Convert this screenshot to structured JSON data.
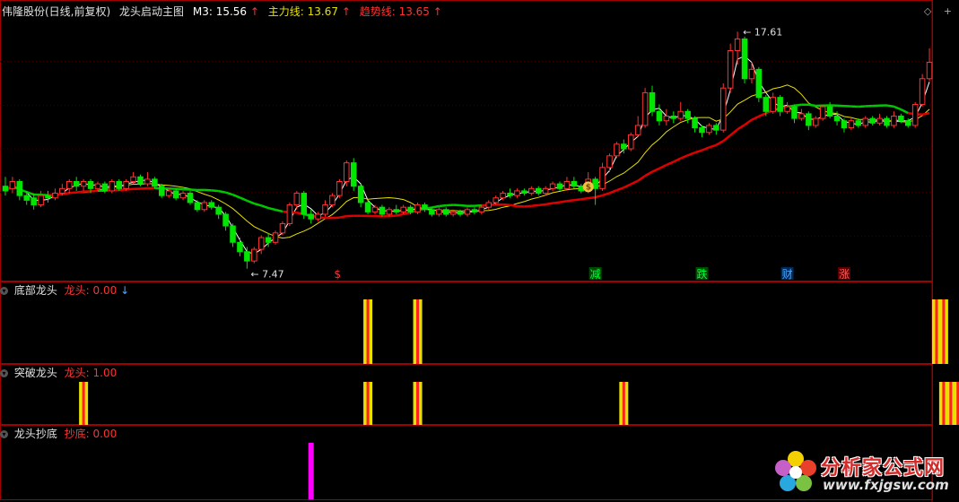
{
  "header": {
    "stock": "伟隆股份(日线,前复权)",
    "indicator": "龙头启动主图",
    "m3_label": "M3: 15.56",
    "main_line_label": "主力线: 13.67",
    "trend_line_label": "趋势线: 13.65",
    "up_arrow": "↑"
  },
  "hud": {
    "diamond": "◇",
    "plus": "+"
  },
  "annotations": {
    "high": "17.61",
    "low": "7.47",
    "money_bag": "$"
  },
  "signals": {
    "s": "$",
    "jian": "减",
    "die": "跌",
    "cai": "财",
    "zhang": "涨"
  },
  "panels": {
    "bottom_dragon": {
      "title": "底部龙头",
      "series_label": "龙头: 0.00",
      "arrow": "↓"
    },
    "breakout_dragon": {
      "title": "突破龙头",
      "series_label": "龙头: 1.00"
    },
    "dragon_bottom": {
      "title": "龙头抄底",
      "series_label": "抄底: 0.00"
    }
  },
  "logo": {
    "name": "分析家公式网",
    "url": "www.fxjgsw.com"
  },
  "colors": {
    "up": "#ff3232",
    "down": "#00e600",
    "ma_white": "#ffffff",
    "ma_yellow": "#e8e000",
    "ma_green": "#00c800",
    "ma_red": "#e00000",
    "signal_yellow": "#e8e000",
    "signal_red": "#ff2020",
    "magenta": "#ff00ff"
  },
  "chart_data": {
    "type": "candlestick",
    "price_range": [
      7.0,
      18.2
    ],
    "candles": [
      [
        11.0,
        10.8,
        11.4,
        10.6
      ],
      [
        10.9,
        11.2,
        11.4,
        10.7
      ],
      [
        11.2,
        10.6,
        11.3,
        10.4
      ],
      [
        10.6,
        10.4,
        10.8,
        10.2
      ],
      [
        10.5,
        10.2,
        10.7,
        10.0
      ],
      [
        10.2,
        10.6,
        10.8,
        10.1
      ],
      [
        10.6,
        10.5,
        10.8,
        10.3
      ],
      [
        10.5,
        10.7,
        10.9,
        10.4
      ],
      [
        10.7,
        10.9,
        11.1,
        10.6
      ],
      [
        10.9,
        11.2,
        11.3,
        10.7
      ],
      [
        11.2,
        11.0,
        11.4,
        10.8
      ],
      [
        11.0,
        11.2,
        11.3,
        10.8
      ],
      [
        11.2,
        10.9,
        11.3,
        10.7
      ],
      [
        10.9,
        11.1,
        11.2,
        10.8
      ],
      [
        11.1,
        10.8,
        11.2,
        10.7
      ],
      [
        10.8,
        11.2,
        11.3,
        10.7
      ],
      [
        11.2,
        10.9,
        11.3,
        10.8
      ],
      [
        10.9,
        11.2,
        11.3,
        10.8
      ],
      [
        11.2,
        11.4,
        11.6,
        11.1
      ],
      [
        11.4,
        11.1,
        11.5,
        11.0
      ],
      [
        11.1,
        11.3,
        11.6,
        11.0
      ],
      [
        11.3,
        11.0,
        11.4,
        10.9
      ],
      [
        11.0,
        10.6,
        11.1,
        10.5
      ],
      [
        10.6,
        10.8,
        10.9,
        10.5
      ],
      [
        10.8,
        10.5,
        10.9,
        10.4
      ],
      [
        10.5,
        10.7,
        10.8,
        10.4
      ],
      [
        10.7,
        10.3,
        10.8,
        10.2
      ],
      [
        10.3,
        10.0,
        10.4,
        9.9
      ],
      [
        10.0,
        10.3,
        10.4,
        9.9
      ],
      [
        10.3,
        10.1,
        10.4,
        10.0
      ],
      [
        10.1,
        9.8,
        10.2,
        9.6
      ],
      [
        9.8,
        9.3,
        9.9,
        9.1
      ],
      [
        9.3,
        8.6,
        9.4,
        8.4
      ],
      [
        8.6,
        8.2,
        8.8,
        8.0
      ],
      [
        8.2,
        7.8,
        8.4,
        7.47
      ],
      [
        7.8,
        8.3,
        8.4,
        7.7
      ],
      [
        8.3,
        8.8,
        8.9,
        8.1
      ],
      [
        8.8,
        8.6,
        9.0,
        8.4
      ],
      [
        8.6,
        9.0,
        9.1,
        8.5
      ],
      [
        9.0,
        9.4,
        9.5,
        8.9
      ],
      [
        9.4,
        10.2,
        10.3,
        9.3
      ],
      [
        10.2,
        10.7,
        10.8,
        10.0
      ],
      [
        10.7,
        9.8,
        10.8,
        9.6
      ],
      [
        9.8,
        9.6,
        10.0,
        9.4
      ],
      [
        9.6,
        9.8,
        9.9,
        9.5
      ],
      [
        9.8,
        10.2,
        10.4,
        9.7
      ],
      [
        10.2,
        10.6,
        10.7,
        10.1
      ],
      [
        10.6,
        11.2,
        11.3,
        10.5
      ],
      [
        11.2,
        12.0,
        12.1,
        11.0
      ],
      [
        12.0,
        11.0,
        12.2,
        10.8
      ],
      [
        11.0,
        10.3,
        11.1,
        10.1
      ],
      [
        10.3,
        9.9,
        10.4,
        9.8
      ],
      [
        9.9,
        10.1,
        10.2,
        9.8
      ],
      [
        10.1,
        9.8,
        10.2,
        9.7
      ],
      [
        9.8,
        10.0,
        10.1,
        9.7
      ],
      [
        10.0,
        9.9,
        10.2,
        9.8
      ],
      [
        9.9,
        10.1,
        10.2,
        9.8
      ],
      [
        10.1,
        9.9,
        10.2,
        9.8
      ],
      [
        9.9,
        10.2,
        10.3,
        9.8
      ],
      [
        10.2,
        10.0,
        10.3,
        9.9
      ],
      [
        10.0,
        9.8,
        10.1,
        9.7
      ],
      [
        9.8,
        10.0,
        10.1,
        9.7
      ],
      [
        10.0,
        9.8,
        10.1,
        9.7
      ],
      [
        9.8,
        9.9,
        10.0,
        9.7
      ],
      [
        9.9,
        9.8,
        10.0,
        9.7
      ],
      [
        9.8,
        10.0,
        10.1,
        9.7
      ],
      [
        10.0,
        9.9,
        10.1,
        9.8
      ],
      [
        9.9,
        10.1,
        10.2,
        9.8
      ],
      [
        10.1,
        10.3,
        10.4,
        10.0
      ],
      [
        10.3,
        10.5,
        10.6,
        10.2
      ],
      [
        10.5,
        10.7,
        10.8,
        10.4
      ],
      [
        10.7,
        10.6,
        10.9,
        10.5
      ],
      [
        10.6,
        10.8,
        10.9,
        10.5
      ],
      [
        10.8,
        10.7,
        10.9,
        10.6
      ],
      [
        10.7,
        10.9,
        11.0,
        10.6
      ],
      [
        10.9,
        10.7,
        11.0,
        10.6
      ],
      [
        10.7,
        10.9,
        11.0,
        10.6
      ],
      [
        10.9,
        11.1,
        11.2,
        10.8
      ],
      [
        11.1,
        10.9,
        11.2,
        10.8
      ],
      [
        10.9,
        11.2,
        11.4,
        10.8
      ],
      [
        11.2,
        11.0,
        11.4,
        10.9
      ],
      [
        11.0,
        10.8,
        11.1,
        10.7
      ],
      [
        10.8,
        11.3,
        11.6,
        10.7
      ],
      [
        11.3,
        10.9,
        11.4,
        10.2
      ],
      [
        10.9,
        11.8,
        12.0,
        10.8
      ],
      [
        11.8,
        12.3,
        12.4,
        11.6
      ],
      [
        12.3,
        12.8,
        12.9,
        12.2
      ],
      [
        12.8,
        12.6,
        13.0,
        12.4
      ],
      [
        12.6,
        13.2,
        13.3,
        12.5
      ],
      [
        13.2,
        13.6,
        14.0,
        13.1
      ],
      [
        13.6,
        15.0,
        15.2,
        13.5
      ],
      [
        15.0,
        14.2,
        15.3,
        14.0
      ],
      [
        14.2,
        13.8,
        14.5,
        13.6
      ],
      [
        13.8,
        14.0,
        14.3,
        13.6
      ],
      [
        14.0,
        13.9,
        14.2,
        13.7
      ],
      [
        13.9,
        14.2,
        14.6,
        13.8
      ],
      [
        14.2,
        13.9,
        14.3,
        13.7
      ],
      [
        13.9,
        13.5,
        14.0,
        13.3
      ],
      [
        13.5,
        13.3,
        13.6,
        13.1
      ],
      [
        13.3,
        13.6,
        13.7,
        13.2
      ],
      [
        13.6,
        13.4,
        13.7,
        13.2
      ],
      [
        13.4,
        15.2,
        15.4,
        13.3
      ],
      [
        15.2,
        16.8,
        17.1,
        15.0
      ],
      [
        16.8,
        17.3,
        17.61,
        16.2
      ],
      [
        17.3,
        15.6,
        17.4,
        15.4
      ],
      [
        15.6,
        16.0,
        16.3,
        15.4
      ],
      [
        16.0,
        14.8,
        16.1,
        14.6
      ],
      [
        14.8,
        14.2,
        14.9,
        14.0
      ],
      [
        14.2,
        14.8,
        15.0,
        14.1
      ],
      [
        14.8,
        14.2,
        14.9,
        14.0
      ],
      [
        14.2,
        14.4,
        14.6,
        14.1
      ],
      [
        14.4,
        13.9,
        14.5,
        13.7
      ],
      [
        13.9,
        14.1,
        14.3,
        13.8
      ],
      [
        14.1,
        13.6,
        14.2,
        13.4
      ],
      [
        13.6,
        13.9,
        14.0,
        13.5
      ],
      [
        13.9,
        14.4,
        14.5,
        13.8
      ],
      [
        14.4,
        14.0,
        14.6,
        13.9
      ],
      [
        14.0,
        13.8,
        14.2,
        13.6
      ],
      [
        13.8,
        13.5,
        13.9,
        13.3
      ],
      [
        13.5,
        13.8,
        13.9,
        13.4
      ],
      [
        13.8,
        13.6,
        13.9,
        13.5
      ],
      [
        13.6,
        13.9,
        14.0,
        13.5
      ],
      [
        13.9,
        13.7,
        14.0,
        13.6
      ],
      [
        13.7,
        13.9,
        14.1,
        13.6
      ],
      [
        13.9,
        13.6,
        14.0,
        13.5
      ],
      [
        13.6,
        14.0,
        14.2,
        13.5
      ],
      [
        14.0,
        13.8,
        14.1,
        13.7
      ],
      [
        13.8,
        13.6,
        13.9,
        13.5
      ],
      [
        13.6,
        14.5,
        14.6,
        13.5
      ],
      [
        14.5,
        15.6,
        15.8,
        14.4
      ],
      [
        15.6,
        16.3,
        16.9,
        15.5
      ]
    ],
    "series": [
      {
        "name": "M3",
        "color": "#ffffff"
      },
      {
        "name": "主力线",
        "color": "#e8e000"
      },
      {
        "name": "趋势线",
        "color": "#e00000"
      }
    ],
    "bottom_dragon_bars": [
      51,
      58,
      131,
      132
    ],
    "breakout_dragon_bars": [
      11,
      51,
      58,
      87,
      132,
      133,
      134
    ],
    "dragon_bottom_bars": [
      43
    ]
  }
}
